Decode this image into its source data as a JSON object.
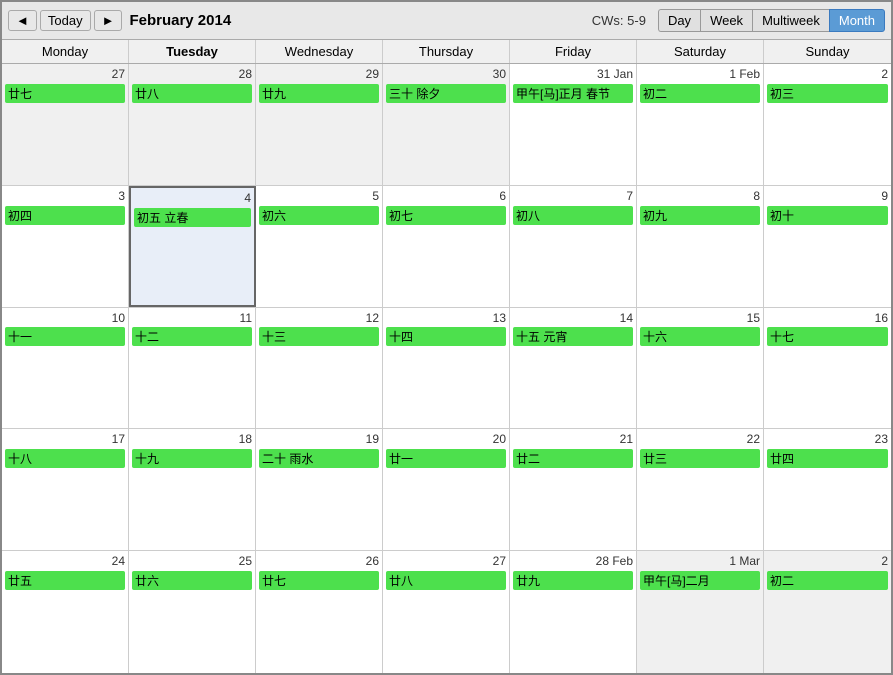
{
  "header": {
    "prev_label": "◄",
    "today_label": "Today",
    "next_label": "►",
    "title": "February 2014",
    "cw_label": "CWs: 5-9",
    "views": [
      "Day",
      "Week",
      "Multiweek",
      "Month"
    ],
    "active_view": "Month"
  },
  "day_headers": [
    {
      "label": "Monday",
      "today": false
    },
    {
      "label": "Tuesday",
      "today": true
    },
    {
      "label": "Wednesday",
      "today": false
    },
    {
      "label": "Thursday",
      "today": false
    },
    {
      "label": "Friday",
      "today": false
    },
    {
      "label": "Saturday",
      "today": false
    },
    {
      "label": "Sunday",
      "today": false
    }
  ],
  "weeks": [
    {
      "days": [
        {
          "date": "27",
          "other": true,
          "today": false,
          "date_suffix": "",
          "events": [
            "廿七"
          ]
        },
        {
          "date": "28",
          "other": true,
          "today": false,
          "date_suffix": "",
          "events": [
            "廿八"
          ]
        },
        {
          "date": "29",
          "other": true,
          "today": false,
          "date_suffix": "",
          "events": [
            "廿九"
          ]
        },
        {
          "date": "30",
          "other": true,
          "today": false,
          "date_suffix": "",
          "events": [
            "三十 除夕"
          ]
        },
        {
          "date": "31",
          "other": false,
          "today": false,
          "date_suffix": " Jan",
          "events": [
            "甲午[马]正月 春节"
          ]
        },
        {
          "date": "1",
          "other": false,
          "today": false,
          "date_suffix": " Feb",
          "events": [
            "初二"
          ]
        },
        {
          "date": "2",
          "other": false,
          "today": false,
          "date_suffix": "",
          "events": [
            "初三"
          ]
        }
      ]
    },
    {
      "days": [
        {
          "date": "3",
          "other": false,
          "today": false,
          "date_suffix": "",
          "events": [
            "初四"
          ]
        },
        {
          "date": "4",
          "other": false,
          "today": true,
          "date_suffix": "",
          "events": [
            "初五 立春"
          ]
        },
        {
          "date": "5",
          "other": false,
          "today": false,
          "date_suffix": "",
          "events": [
            "初六"
          ]
        },
        {
          "date": "6",
          "other": false,
          "today": false,
          "date_suffix": "",
          "events": [
            "初七"
          ]
        },
        {
          "date": "7",
          "other": false,
          "today": false,
          "date_suffix": "",
          "events": [
            "初八"
          ]
        },
        {
          "date": "8",
          "other": false,
          "today": false,
          "date_suffix": "",
          "events": [
            "初九"
          ]
        },
        {
          "date": "9",
          "other": false,
          "today": false,
          "date_suffix": "",
          "events": [
            "初十"
          ]
        }
      ]
    },
    {
      "days": [
        {
          "date": "10",
          "other": false,
          "today": false,
          "date_suffix": "",
          "events": [
            "十一"
          ]
        },
        {
          "date": "11",
          "other": false,
          "today": false,
          "date_suffix": "",
          "events": [
            "十二"
          ]
        },
        {
          "date": "12",
          "other": false,
          "today": false,
          "date_suffix": "",
          "events": [
            "十三"
          ]
        },
        {
          "date": "13",
          "other": false,
          "today": false,
          "date_suffix": "",
          "events": [
            "十四"
          ]
        },
        {
          "date": "14",
          "other": false,
          "today": false,
          "date_suffix": "",
          "events": [
            "十五 元宵"
          ]
        },
        {
          "date": "15",
          "other": false,
          "today": false,
          "date_suffix": "",
          "events": [
            "十六"
          ]
        },
        {
          "date": "16",
          "other": false,
          "today": false,
          "date_suffix": "",
          "events": [
            "十七"
          ]
        }
      ]
    },
    {
      "days": [
        {
          "date": "17",
          "other": false,
          "today": false,
          "date_suffix": "",
          "events": [
            "十八"
          ]
        },
        {
          "date": "18",
          "other": false,
          "today": false,
          "date_suffix": "",
          "events": [
            "十九"
          ]
        },
        {
          "date": "19",
          "other": false,
          "today": false,
          "date_suffix": "",
          "events": [
            "二十 雨水"
          ]
        },
        {
          "date": "20",
          "other": false,
          "today": false,
          "date_suffix": "",
          "events": [
            "廿一"
          ]
        },
        {
          "date": "21",
          "other": false,
          "today": false,
          "date_suffix": "",
          "events": [
            "廿二"
          ]
        },
        {
          "date": "22",
          "other": false,
          "today": false,
          "date_suffix": "",
          "events": [
            "廿三"
          ]
        },
        {
          "date": "23",
          "other": false,
          "today": false,
          "date_suffix": "",
          "events": [
            "廿四"
          ]
        }
      ]
    },
    {
      "days": [
        {
          "date": "24",
          "other": false,
          "today": false,
          "date_suffix": "",
          "events": [
            "廿五"
          ]
        },
        {
          "date": "25",
          "other": false,
          "today": false,
          "date_suffix": "",
          "events": [
            "廿六"
          ]
        },
        {
          "date": "26",
          "other": false,
          "today": false,
          "date_suffix": "",
          "events": [
            "廿七"
          ]
        },
        {
          "date": "27",
          "other": false,
          "today": false,
          "date_suffix": "",
          "events": [
            "廿八"
          ]
        },
        {
          "date": "28",
          "other": false,
          "today": false,
          "date_suffix": " Feb",
          "events": [
            "廿九"
          ]
        },
        {
          "date": "1",
          "other": true,
          "today": false,
          "date_suffix": " Mar",
          "events": [
            "甲午[马]二月"
          ]
        },
        {
          "date": "2",
          "other": true,
          "today": false,
          "date_suffix": "",
          "events": [
            "初二"
          ]
        }
      ]
    }
  ]
}
